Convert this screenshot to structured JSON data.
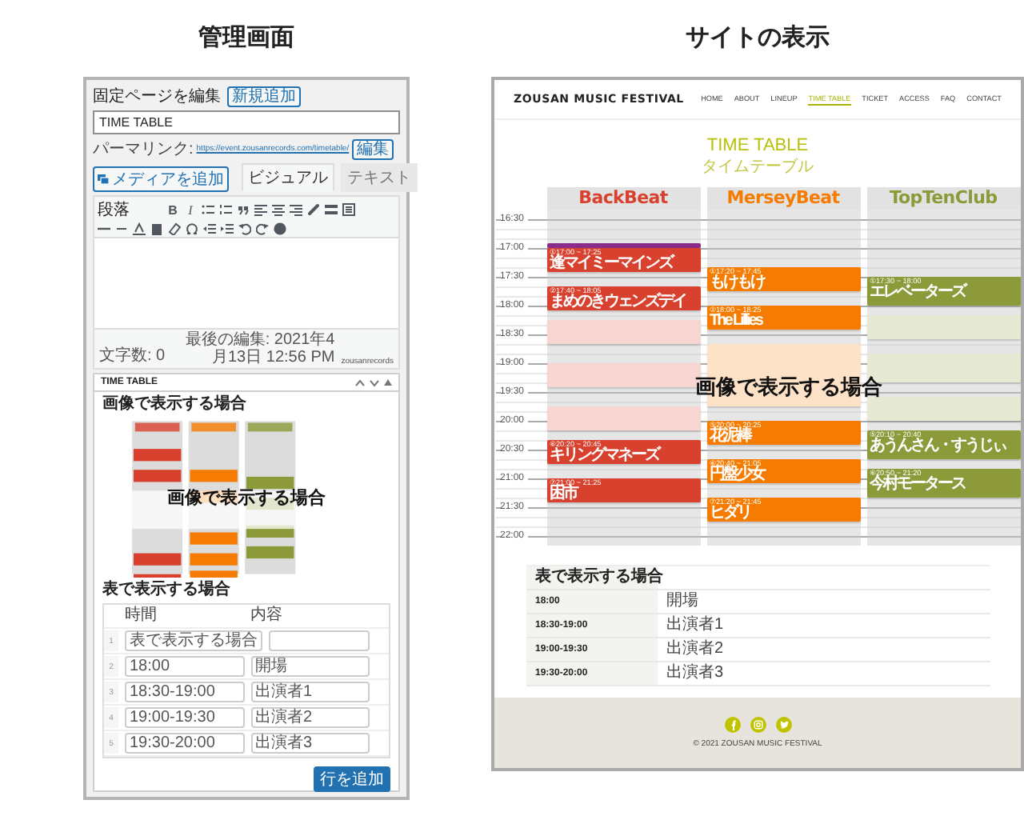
{
  "admin": {
    "heading": "管理画面",
    "page_title": "固定ページを編集",
    "add_new": "新規追加",
    "title_value": "TIME TABLE",
    "permalink_label": "パーマリンク:",
    "permalink_url": "https://event.zousanrecords.com/timetable/",
    "permalink_edit": "編集",
    "media_button": "メディアを追加",
    "editor_tabs": [
      {
        "label": "ビジュアル",
        "selected": true
      },
      {
        "label": "テキスト",
        "selected": false
      }
    ],
    "format_select": "段落",
    "format_buttons": [
      "B",
      "I"
    ],
    "word_count": "文字数: 0",
    "last_edited": "最後の編集: 2021年4月13日 12:56 PM",
    "last_editor": "zousanrecords",
    "metabox": {
      "title": "TIME TABLE",
      "image_label": "画像で表示する場合",
      "image_overlay": "画像で表示する場合",
      "table_label": "表で表示する場合",
      "columns": [
        "時間",
        "内容"
      ],
      "rows": [
        {
          "number": "1",
          "time": "表で表示する場合"
        },
        {
          "number": "2",
          "time": "18:00",
          "content": "開場"
        },
        {
          "number": "3",
          "time": "18:30-19:00",
          "content": "出演者1"
        },
        {
          "number": "4",
          "time": "19:00-19:30",
          "content": "出演者2"
        },
        {
          "number": "5",
          "time": "19:30-20:00",
          "content": "出演者3"
        }
      ],
      "add_row": "行を追加"
    }
  },
  "site": {
    "heading": "サイトの表示",
    "logo": "ZOUSAN MUSIC FESTIVAL",
    "nav": [
      {
        "label": "HOME",
        "selected": false
      },
      {
        "label": "ABOUT",
        "selected": false
      },
      {
        "label": "LINEUP",
        "selected": false
      },
      {
        "label": "TIME TABLE",
        "selected": true
      },
      {
        "label": "TICKET",
        "selected": false
      },
      {
        "label": "ACCESS",
        "selected": false
      },
      {
        "label": "FAQ",
        "selected": false
      },
      {
        "label": "CONTACT",
        "selected": false
      }
    ],
    "title": "TIME TABLE",
    "subtitle": "タイムテーブル",
    "times": [
      "16:30",
      "17:00",
      "17:30",
      "18:00",
      "18:30",
      "19:00",
      "19:30",
      "20:00",
      "20:30",
      "21:00",
      "21:30",
      "22:00"
    ],
    "stages": [
      {
        "name": "BackBeat",
        "color": "#d9412f",
        "blocks": [
          {
            "kind": "notice",
            "faded": false
          },
          {
            "kind": "act",
            "time": "①17:00 ~ 17:25",
            "name": "逢マイミーマインズ",
            "faded": false
          },
          {
            "kind": "act",
            "time": "②17:40 ~ 18:05",
            "name": "まめのきウェンズデイ",
            "faded": false
          },
          {
            "kind": "act",
            "faded": true
          },
          {
            "kind": "act",
            "faded": true
          },
          {
            "kind": "act",
            "faded": true
          },
          {
            "kind": "act",
            "time": "⑥20:20 ~ 20:45",
            "name": "キリングマネーズ",
            "faded": false
          },
          {
            "kind": "act",
            "time": "⑦21:00 ~ 21:25",
            "name": "困市",
            "faded": false
          }
        ]
      },
      {
        "name": "MerseyBeat",
        "color": "#f57c00",
        "blocks": [
          {
            "kind": "act",
            "time": "①17:20 ~ 17:45",
            "name": "もけもけ",
            "faded": false
          },
          {
            "kind": "act",
            "time": "②18:00 ~ 18:25",
            "name": "The Lillies",
            "faded": false
          },
          {
            "kind": "act",
            "faded": true
          },
          {
            "kind": "act",
            "time": "⑤20:00 ~ 20:25",
            "name": "花泥棒",
            "faded": false
          },
          {
            "kind": "act",
            "time": "⑥20:40 ~ 21:05",
            "name": "円盤少女",
            "faded": false
          },
          {
            "kind": "act",
            "time": "⑦21:20 ~ 21:45",
            "name": "ヒダリ",
            "faded": false
          }
        ]
      },
      {
        "name": "TopTenClub",
        "color": "#8c9a3a",
        "blocks": [
          {
            "kind": "act",
            "time": "①17:30 ~ 18:00",
            "name": "エレベーターズ",
            "faded": false
          },
          {
            "kind": "act",
            "faded": true
          },
          {
            "kind": "act",
            "faded": true
          },
          {
            "kind": "act",
            "faded": true
          },
          {
            "kind": "act",
            "time": "⑤20:10 ~ 20:40",
            "name": "あうんさん・すうじぃ",
            "faded": false
          },
          {
            "kind": "act",
            "time": "⑥20:50 ~ 21:20",
            "name": "今村モータース",
            "faded": false
          }
        ]
      }
    ],
    "overlay": "画像で表示する場合",
    "table": [
      {
        "time": "表で表示する場合"
      },
      {
        "time": "18:00",
        "content": "開場"
      },
      {
        "time": "18:30-19:00",
        "content": "出演者1"
      },
      {
        "time": "19:00-19:30",
        "content": "出演者2"
      },
      {
        "time": "19:30-20:00",
        "content": "出演者3"
      }
    ],
    "copyright": "© 2021 ZOUSAN MUSIC FESTIVAL"
  }
}
